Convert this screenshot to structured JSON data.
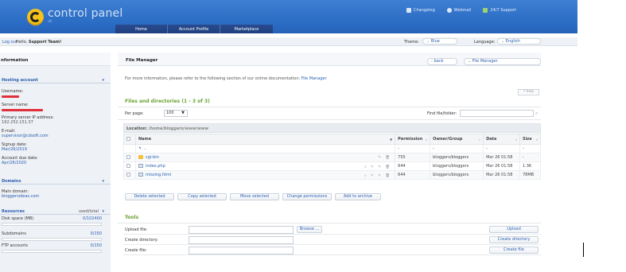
{
  "header": {
    "brand": "control panel",
    "brand_sub": "v8",
    "top_links": [
      "Changelog",
      "Webmail",
      "24/7 Support"
    ],
    "nav": [
      "Home",
      "Account Profile",
      "Marketplace"
    ]
  },
  "subbar": {
    "logout": "Log out",
    "hello_prefix": "Hello,",
    "hello_name": "Support Team!",
    "theme_label": "Theme:",
    "theme_value": "Blue",
    "language_label": "Language:",
    "language_value": "English"
  },
  "sidebar": {
    "title": "nformation",
    "hosting_head": "Hosting account",
    "username_label": "Username:",
    "server_name_label": "Server name:",
    "ip_label": "Primary server IP address:",
    "ip_value": "192.252.151.37",
    "email_label": "E-mail:",
    "email_value": "supervisor@cdsoft.com",
    "signup_label": "Signup date:",
    "signup_value": "Mar/26/2019",
    "due_label": "Account due date:",
    "due_value": "Apr/26/2020",
    "domains_head": "Domains",
    "main_domain_label": "Main domain:",
    "main_domain_value": "bloggersideas.com",
    "resources_head": "Resources",
    "resources_cols": "used/total",
    "resources": [
      {
        "label": "Disk space (MB)",
        "value": "0/102400"
      },
      {
        "label": "Subdomains",
        "value": "0/150"
      },
      {
        "label": "FTP accounts",
        "value": "0/150"
      }
    ]
  },
  "main": {
    "title": "File Manager",
    "back": "back",
    "crumb": "File Manager",
    "info_text": "For more information, please refer to the following section of our online documentation:",
    "info_link": "File Manager",
    "help": "help",
    "files_title": "Files and directories (1 - 3 of 3)",
    "per_page_label": "Per page:",
    "per_page_value": "100",
    "find_label": "Find file/folder:",
    "location_label": "Location:",
    "location_value": "/home/bloggers/www/www",
    "columns": [
      "Name",
      "Permission",
      "Owner/Group",
      "Date",
      "Size"
    ],
    "rows": [
      {
        "name": "..",
        "perm": "-",
        "owner": "-",
        "date": "-",
        "size": "-"
      },
      {
        "name": "cgi-bin",
        "perm": "755",
        "owner": "bloggers/bloggers",
        "date": "Mar 26 01:58",
        "size": "-"
      },
      {
        "name": "index.php",
        "perm": "644",
        "owner": "bloggers/bloggers",
        "date": "Mar 26 01:58",
        "size": "1.3K"
      },
      {
        "name": "missing.html",
        "perm": "644",
        "owner": "bloggers/bloggers",
        "date": "Mar 26 01:58",
        "size": "78MB"
      }
    ],
    "buttons": [
      "Delete selected",
      "Copy selected",
      "Move selected",
      "Change permissions",
      "Add to archive"
    ],
    "tools_title": "Tools",
    "tools": [
      {
        "label": "Upload file:",
        "browse": "Browse ...",
        "action": "Upload"
      },
      {
        "label": "Create directory:",
        "action": "Create directory"
      },
      {
        "label": "Create file:",
        "action": "Create file"
      }
    ]
  },
  "colors": {
    "header_blue": "#2b6cc4",
    "nav_dark": "#1e3f7e",
    "link_blue": "#2a5fb0",
    "section_green": "#6aa532",
    "logo_yellow": "#f5c21b"
  }
}
